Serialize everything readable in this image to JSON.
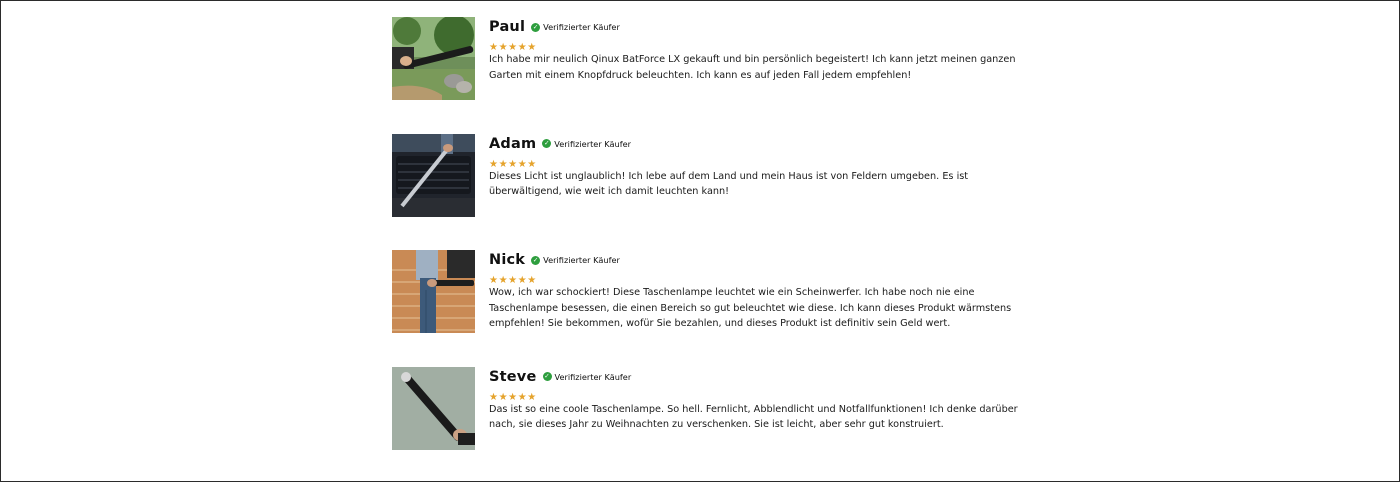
{
  "reviews": [
    {
      "name": "Paul",
      "verified_label": "Verifizierter Käufer",
      "rating": 5,
      "stars": "★★★★★",
      "image": "man-holding-flashlight-in-garden-photo",
      "text": "Ich habe mir neulich Qinux BatForce LX gekauft und bin persönlich begeistert! Ich kann jetzt meinen ganzen Garten mit einem Knopfdruck beleuchten. Ich kann es auf jeden Fall jedem empfehlen!"
    },
    {
      "name": "Adam",
      "verified_label": "Verifizierter Käufer",
      "rating": 5,
      "stars": "★★★★★",
      "image": "flashlight-near-car-grille-photo",
      "text": "Dieses Licht ist unglaublich! Ich lebe auf dem Land und mein Haus ist von Feldern umgeben. Es ist überwältigend, wie weit ich damit leuchten kann!"
    },
    {
      "name": "Nick",
      "verified_label": "Verifizierter Käufer",
      "rating": 5,
      "stars": "★★★★★",
      "image": "person-holding-flashlight-on-brick-driveway-photo",
      "text": "Wow, ich war schockiert! Diese Taschenlampe leuchtet wie ein Scheinwerfer. Ich habe noch nie eine Taschenlampe besessen, die einen Bereich so gut beleuchtet wie diese. Ich kann dieses Produkt wärmstens empfehlen! Sie bekommen, wofür Sie bezahlen, und dieses Produkt ist definitiv sein Geld wert."
    },
    {
      "name": "Steve",
      "verified_label": "Verifizierter Käufer",
      "rating": 5,
      "stars": "★★★★★",
      "image": "hand-holding-black-flashlight-photo",
      "text": "Das ist so eine coole Taschenlampe. So hell. Fernlicht, Abblendlicht und Notfallfunktionen! Ich denke darüber nach, sie dieses Jahr zu Weihnachten zu verschenken. Sie ist leicht, aber sehr gut konstruiert."
    }
  ],
  "colors": {
    "star": "#e5a32c",
    "verified_check": "#2e9e3e",
    "text": "#1a1a1a"
  }
}
